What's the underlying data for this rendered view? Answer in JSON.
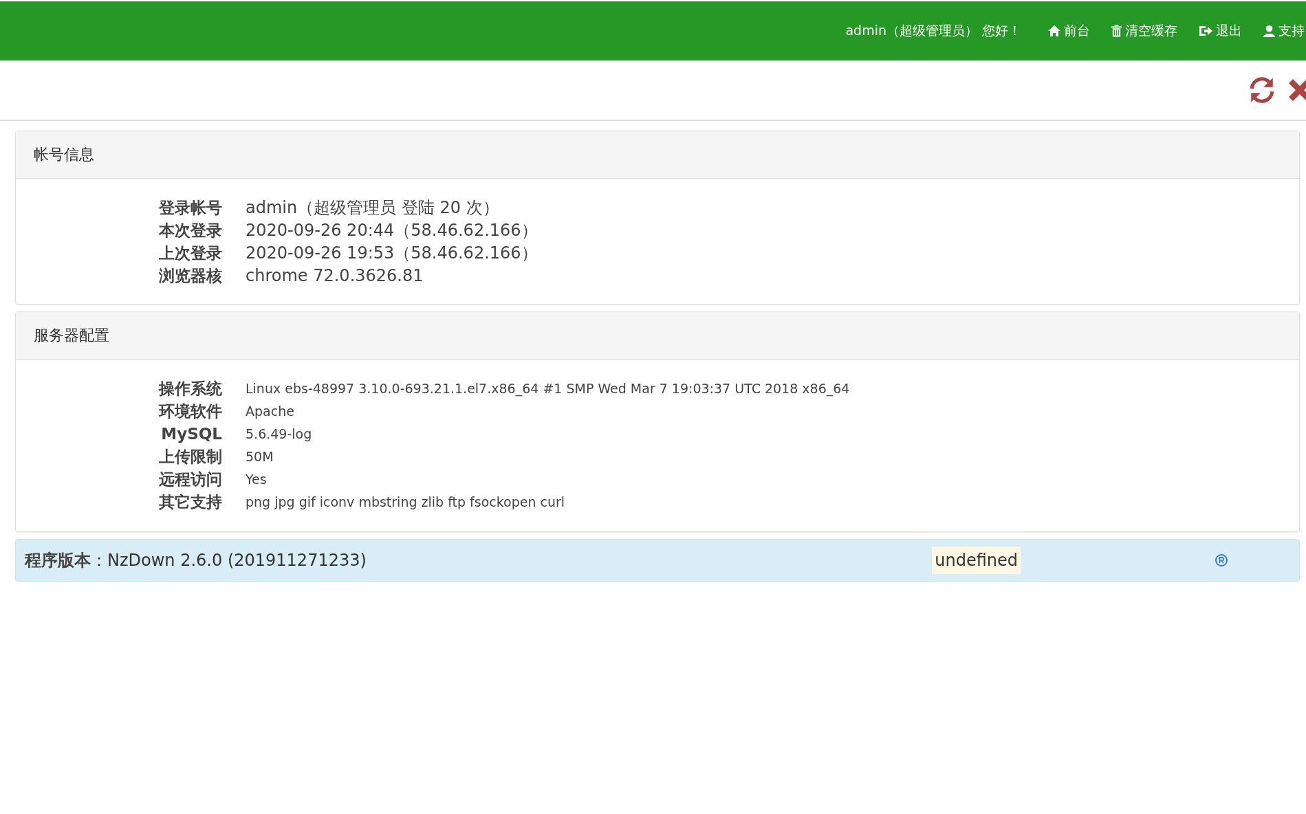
{
  "topbar": {
    "greeting": "admin（超级管理员） 您好！",
    "links": [
      {
        "kind": "home",
        "label": "前台"
      },
      {
        "kind": "trash",
        "label": "清空缓存"
      },
      {
        "kind": "logout",
        "label": "退出"
      },
      {
        "kind": "user",
        "label": "支持"
      }
    ]
  },
  "toolbar": {
    "actions": [
      {
        "kind": "refresh"
      },
      {
        "kind": "close"
      }
    ]
  },
  "panels": [
    {
      "title": "帐号信息",
      "kind": "large",
      "rows": [
        {
          "label": "登录帐号",
          "value": "admin（超级管理员 登陆 20 次）"
        },
        {
          "label": "本次登录",
          "value": "2020-09-26 20:44（58.46.62.166）"
        },
        {
          "label": "上次登录",
          "value": "2020-09-26 19:53（58.46.62.166）"
        },
        {
          "label": "浏览器核",
          "value": "chrome 72.0.3626.81"
        }
      ]
    },
    {
      "title": "服务器配置",
      "kind": "compact",
      "rows": [
        {
          "label": "操作系统",
          "value": "Linux ebs-48997 3.10.0-693.21.1.el7.x86_64 #1 SMP Wed Mar 7 19:03:37 UTC 2018 x86_64"
        },
        {
          "label": "环境软件",
          "value": "Apache"
        },
        {
          "label": "MySQL",
          "value": "5.6.49-log"
        },
        {
          "label": "上传限制",
          "value": "50M"
        },
        {
          "label": "远程访问",
          "value": "Yes"
        },
        {
          "label": "其它支持",
          "value": "png jpg gif iconv mbstring zlib ftp fsockopen curl"
        }
      ]
    }
  ],
  "version_bar": {
    "text": "**程序版本**：NzDown 2.6.0 (201911271233)",
    "status": "undefined"
  }
}
